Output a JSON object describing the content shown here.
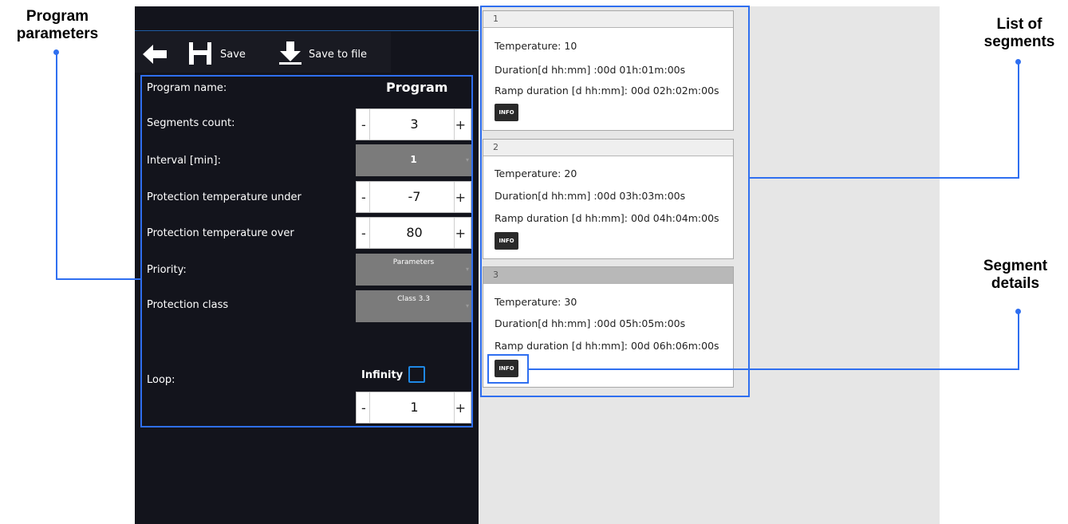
{
  "annotations": {
    "program_parameters": [
      "Program",
      "parameters"
    ],
    "list_of_segments": [
      "List of",
      "segments"
    ],
    "segment_details": [
      "Segment",
      "details"
    ]
  },
  "colors": {
    "accent": "#2f6ff0",
    "panel": "#13141c",
    "checkbox": "#1e88e5"
  },
  "toolbar": {
    "back_icon": "arrow-left-icon",
    "save_label": "Save",
    "save_to_file_label": "Save to file"
  },
  "params": {
    "program_name_label": "Program name:",
    "program_name_value": "Program",
    "segments_count_label": "Segments count:",
    "segments_count_value": "3",
    "interval_label": "Interval [min]:",
    "interval_value": "1",
    "protection_under_label": "Protection temperature under",
    "protection_under_value": "-7",
    "protection_over_label": "Protection temperature over",
    "protection_over_value": "80",
    "priority_label": "Priority:",
    "priority_value": "Parameters",
    "protection_class_label": "Protection class",
    "protection_class_value": "Class 3.3",
    "loop_label": "Loop:",
    "infinity_label": "Infinity",
    "loop_value": "1",
    "minus": "-",
    "plus": "+"
  },
  "segments": [
    {
      "number": "1",
      "temperature": "Temperature: 10",
      "duration": "Duration[d hh:mm] :00d 01h:01m:00s",
      "ramp": "Ramp duration [d hh:mm]: 00d 02h:02m:00s",
      "info": "INFO"
    },
    {
      "number": "2",
      "temperature": "Temperature: 20",
      "duration": "Duration[d hh:mm] :00d 03h:03m:00s",
      "ramp": "Ramp duration [d hh:mm]: 00d 04h:04m:00s",
      "info": "INFO"
    },
    {
      "number": "3",
      "temperature": "Temperature: 30",
      "duration": "Duration[d hh:mm] :00d 05h:05m:00s",
      "ramp": "Ramp duration [d hh:mm]: 00d 06h:06m:00s",
      "info": "INFO"
    }
  ]
}
